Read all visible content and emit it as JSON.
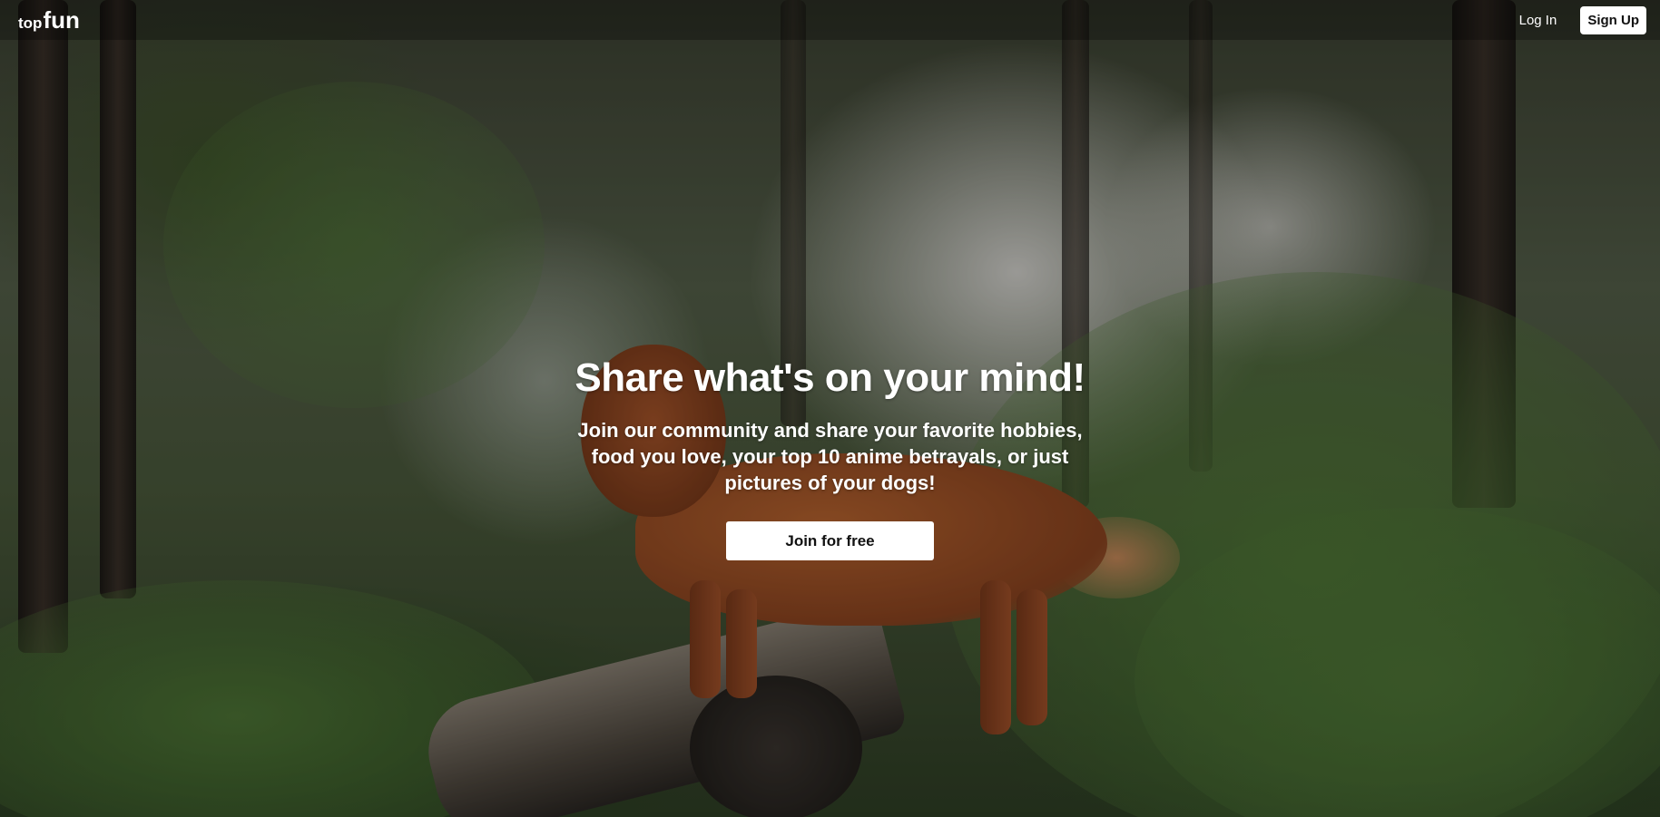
{
  "header": {
    "logo_prefix": "top",
    "logo_main": "fun",
    "login_label": "Log In",
    "signup_label": "Sign Up"
  },
  "hero": {
    "headline": "Share what's on your mind!",
    "subtext": "Join our community and share your favorite hobbies, food you love, your top 10 anime betrayals, or just pictures of your dogs!",
    "cta_label": "Join for free",
    "background_image": "dog-in-forest-photo"
  }
}
